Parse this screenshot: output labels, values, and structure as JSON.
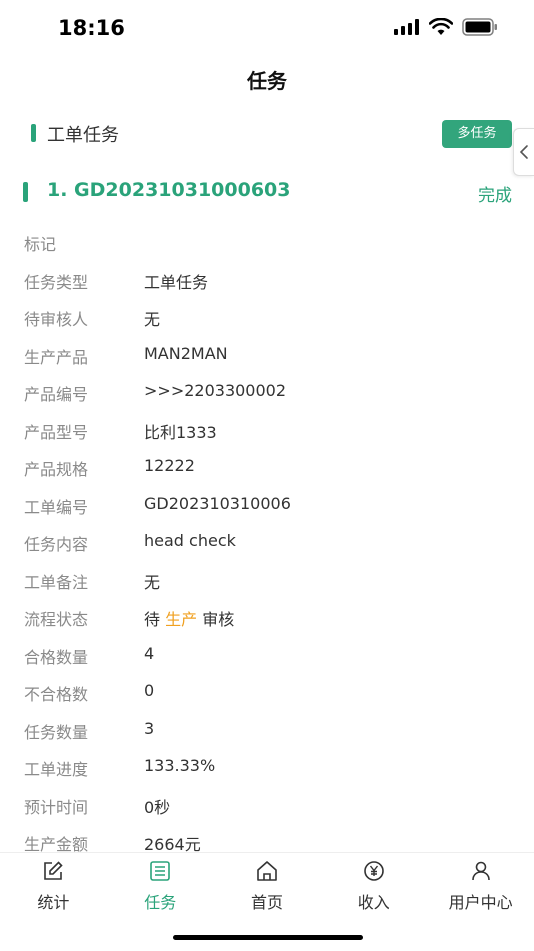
{
  "status_bar": {
    "time": "18:16"
  },
  "nav": {
    "title": "任务"
  },
  "section": {
    "title": "工单任务",
    "multi_task_label": "多任务"
  },
  "task": {
    "title": "1. GD2023103100​0603",
    "status": "完成"
  },
  "details": [
    {
      "label": "标记",
      "value": ""
    },
    {
      "label": "任务类型",
      "value": "工单任务"
    },
    {
      "label": "待审核人",
      "value": "无"
    },
    {
      "label": "生产产品",
      "value": "MAN2MAN"
    },
    {
      "label": "产品编号",
      "value": ">>>2203300002"
    },
    {
      "label": "产品型号",
      "value": "比利1333"
    },
    {
      "label": "产品规格",
      "value": "12222"
    },
    {
      "label": "工单编号",
      "value": "GD202310310006"
    },
    {
      "label": "任务内容",
      "value": "head check"
    },
    {
      "label": "工单备注",
      "value": "无"
    },
    {
      "label": "流程状态",
      "value_prefix": "待",
      "value_highlight": "生产",
      "value_suffix": "审核"
    },
    {
      "label": "合格数量",
      "value": "4"
    },
    {
      "label": "不合格数",
      "value": "0"
    },
    {
      "label": "任务数量",
      "value": "3"
    },
    {
      "label": "工单进度",
      "value": "133.33%"
    },
    {
      "label": "预计时间",
      "value": "0秒"
    },
    {
      "label": "生产金额",
      "value": "2664元"
    }
  ],
  "tabbar": [
    {
      "label": "统计",
      "icon": "edit-icon",
      "active": false
    },
    {
      "label": "任务",
      "icon": "task-list-icon",
      "active": true
    },
    {
      "label": "首页",
      "icon": "home-icon",
      "active": false
    },
    {
      "label": "收入",
      "icon": "yuan-icon",
      "active": false
    },
    {
      "label": "用户中心",
      "icon": "user-icon",
      "active": false
    }
  ],
  "colors": {
    "accent": "#2aa37a",
    "highlight": "#f0a020"
  }
}
